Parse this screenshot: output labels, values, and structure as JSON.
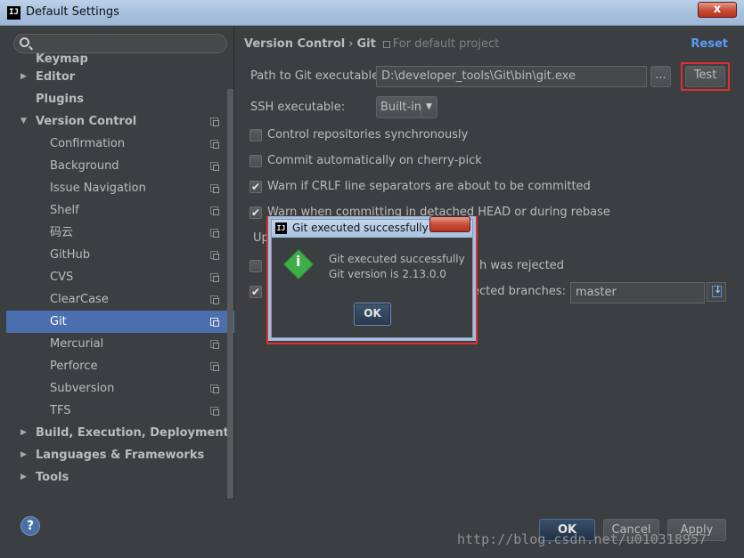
{
  "window": {
    "title": "Default Settings",
    "app_icon": "IJ",
    "close_label": "x"
  },
  "search": {
    "placeholder": "",
    "value": ""
  },
  "sidebar": {
    "items": [
      {
        "label": "Keymap",
        "level": 0,
        "bold": true,
        "arrow": "",
        "copy": false
      },
      {
        "label": "Editor",
        "level": 0,
        "bold": true,
        "arrow": "▶",
        "copy": false
      },
      {
        "label": "Plugins",
        "level": 0,
        "bold": true,
        "arrow": "",
        "copy": false
      },
      {
        "label": "Version Control",
        "level": 0,
        "bold": true,
        "arrow": "▼",
        "copy": true
      },
      {
        "label": "Confirmation",
        "level": 1,
        "bold": false,
        "arrow": "",
        "copy": true
      },
      {
        "label": "Background",
        "level": 1,
        "bold": false,
        "arrow": "",
        "copy": true
      },
      {
        "label": "Issue Navigation",
        "level": 1,
        "bold": false,
        "arrow": "",
        "copy": true
      },
      {
        "label": "Shelf",
        "level": 1,
        "bold": false,
        "arrow": "",
        "copy": true
      },
      {
        "label": "码云",
        "level": 1,
        "bold": false,
        "arrow": "",
        "copy": true
      },
      {
        "label": "GitHub",
        "level": 1,
        "bold": false,
        "arrow": "",
        "copy": true
      },
      {
        "label": "CVS",
        "level": 1,
        "bold": false,
        "arrow": "",
        "copy": true
      },
      {
        "label": "ClearCase",
        "level": 1,
        "bold": false,
        "arrow": "",
        "copy": true
      },
      {
        "label": "Git",
        "level": 1,
        "bold": false,
        "arrow": "",
        "copy": true,
        "selected": true
      },
      {
        "label": "Mercurial",
        "level": 1,
        "bold": false,
        "arrow": "",
        "copy": true
      },
      {
        "label": "Perforce",
        "level": 1,
        "bold": false,
        "arrow": "",
        "copy": true
      },
      {
        "label": "Subversion",
        "level": 1,
        "bold": false,
        "arrow": "",
        "copy": true
      },
      {
        "label": "TFS",
        "level": 1,
        "bold": false,
        "arrow": "",
        "copy": true
      },
      {
        "label": "Build, Execution, Deployment",
        "level": 0,
        "bold": true,
        "arrow": "▶",
        "copy": false
      },
      {
        "label": "Languages & Frameworks",
        "level": 0,
        "bold": true,
        "arrow": "▶",
        "copy": false
      },
      {
        "label": "Tools",
        "level": 0,
        "bold": true,
        "arrow": "▶",
        "copy": false
      }
    ]
  },
  "breadcrumb": {
    "part1": "Version Control",
    "sep": "›",
    "part2": "Git",
    "hint": "For default project"
  },
  "reset_label": "Reset",
  "git_path": {
    "label": "Path to Git executable:",
    "value": "D:\\developer_tools\\Git\\bin\\git.exe",
    "browse_label": "...",
    "test_label": "Test"
  },
  "ssh": {
    "label": "SSH executable:",
    "value": "Built-in"
  },
  "checkboxes": [
    {
      "label": "Control repositories synchronously",
      "checked": false
    },
    {
      "label": "Commit automatically on cherry-pick",
      "checked": false
    },
    {
      "label": "Warn if CRLF line separators are about to be committed",
      "checked": true
    },
    {
      "label": "Warn when committing in detached HEAD or during rebase",
      "checked": true
    }
  ],
  "partial": {
    "update_label": "Up",
    "push_rejected_tail": "h was rejected",
    "protected_tail": "ected branches:",
    "protected_value": "master"
  },
  "dialog": {
    "title": "Git executed successfully",
    "line1": "Git executed successfully",
    "line2": "Git version is 2.13.0.0",
    "ok_label": "OK"
  },
  "buttons": {
    "ok": "OK",
    "cancel": "Cancel",
    "apply": "Apply",
    "help": "?"
  },
  "watermark": "http://blog.csdn.net/u010318957",
  "colors": {
    "selection": "#4b6eaf",
    "link": "#589df6",
    "highlight": "#e02f2f",
    "info_icon": "#3fae49"
  }
}
